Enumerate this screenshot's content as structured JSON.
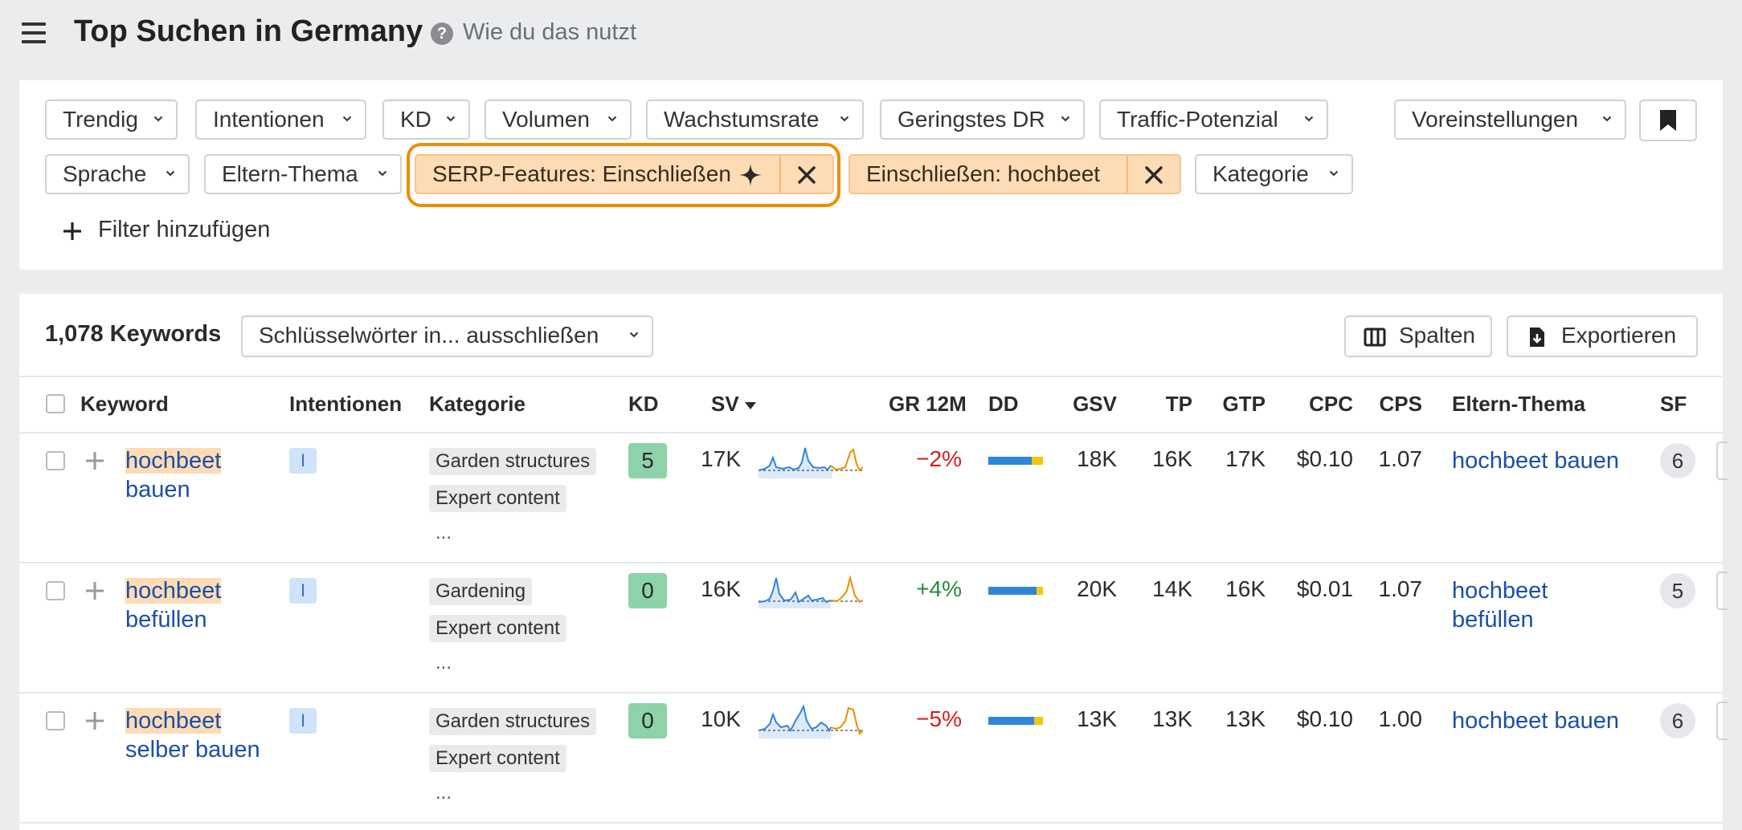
{
  "header": {
    "title": "Top Suchen in Germany",
    "help_label": "Wie du das nutzt"
  },
  "filters": {
    "row1": [
      "Trendig",
      "Intentionen",
      "KD",
      "Volumen",
      "Wachstumsrate",
      "Geringstes DR",
      "Traffic-Potenzial"
    ],
    "presets": "Voreinstellungen",
    "row2_first": [
      "Sprache",
      "Eltern-Thema"
    ],
    "serp_features": "SERP-Features: Einschließen",
    "include": "Einschließen: hochbeet",
    "category": "Kategorie",
    "add_filter": "Filter hinzufügen"
  },
  "toolbar": {
    "keyword_count": "1,078 Keywords",
    "exclude": "Schlüsselwörter in... ausschließen",
    "columns": "Spalten",
    "export": "Exportieren"
  },
  "table": {
    "columns": [
      "Keyword",
      "Intentionen",
      "Kategorie",
      "KD",
      "SV",
      "GR 12M",
      "DD",
      "GSV",
      "TP",
      "GTP",
      "CPC",
      "CPS",
      "Eltern-Thema",
      "SF"
    ],
    "sorted_column": "SV",
    "rows": [
      {
        "kw_hl": "hochbeet",
        "kw_rest": "bauen",
        "intent": "I",
        "categories": [
          "Garden structures",
          "Expert content"
        ],
        "more": "...",
        "kd": "5",
        "sv": "17K",
        "gr": "−2%",
        "gr_dir": "neg",
        "dd": [
          0.8,
          0.2
        ],
        "gsv": "18K",
        "tp": "16K",
        "gtp": "17K",
        "cpc": "$0.10",
        "cps": "1.07",
        "parent": "hochbeet bauen",
        "sf": "6"
      },
      {
        "kw_hl": "hochbeet",
        "kw_rest": "befüllen",
        "intent": "I",
        "categories": [
          "Gardening",
          "Expert content"
        ],
        "more": "...",
        "kd": "0",
        "sv": "16K",
        "gr": "+4%",
        "gr_dir": "pos",
        "dd": [
          0.88,
          0.12
        ],
        "gsv": "20K",
        "tp": "14K",
        "gtp": "16K",
        "cpc": "$0.01",
        "cps": "1.07",
        "parent": "hochbeet befüllen",
        "sf": "5"
      },
      {
        "kw_hl": "hochbeet",
        "kw_rest": "selber bauen",
        "intent": "I",
        "categories": [
          "Garden structures",
          "Expert content"
        ],
        "more": "...",
        "kd": "0",
        "sv": "10K",
        "gr": "−5%",
        "gr_dir": "neg",
        "dd": [
          0.84,
          0.16
        ],
        "gsv": "13K",
        "tp": "13K",
        "gtp": "13K",
        "cpc": "$0.10",
        "cps": "1.00",
        "parent": "hochbeet bauen",
        "sf": "6"
      }
    ]
  },
  "colors": {
    "accent_orange": "#f08c00",
    "filter_active_bg": "#fddcb5",
    "link_blue": "#1a4fa8",
    "kd_green": "#8cd3a9",
    "dd_blue": "#2f86d8",
    "dd_yellow": "#f3c710"
  },
  "icons": [
    "menu-icon",
    "help-icon",
    "chevron-down-icon",
    "sparkle-icon",
    "close-icon",
    "bookmark-icon",
    "plus-icon",
    "columns-icon",
    "export-icon",
    "sort-down-icon"
  ]
}
